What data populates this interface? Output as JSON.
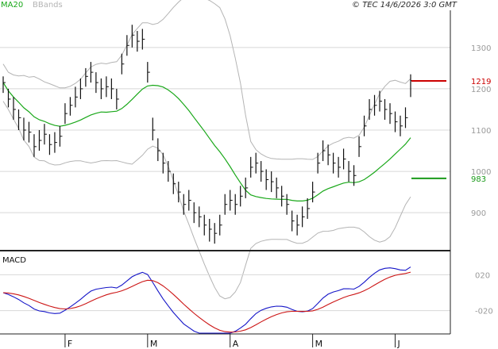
{
  "header": {
    "legend_ma": "MA20",
    "legend_bbands": "BBands",
    "credit": "© TEC 14/6/2026 3:0 GMT",
    "ma_color": "#1aa81a",
    "bbands_color": "#b4b4b4"
  },
  "chart_data": [
    {
      "type": "ohlc",
      "panel": "price",
      "y_ticks": [
        "1300",
        "1200",
        "1100",
        "1000",
        "900"
      ],
      "ylim": [
        810,
        1390
      ],
      "x_ticks": [
        "F",
        "M",
        "A",
        "M",
        "J"
      ],
      "x_tick_index": [
        12,
        28,
        44,
        60,
        76
      ],
      "markers": [
        {
          "label": "1219",
          "value": 1219,
          "color": "#cc0000"
        },
        {
          "label": "983",
          "value": 983,
          "color": "#1a9a1a"
        }
      ],
      "close": [
        1215,
        1175,
        1150,
        1130,
        1100,
        1095,
        1060,
        1075,
        1090,
        1065,
        1070,
        1085,
        1140,
        1160,
        1180,
        1200,
        1230,
        1240,
        1215,
        1200,
        1205,
        1200,
        1175,
        1260,
        1305,
        1330,
        1315,
        1320,
        1240,
        1100,
        1050,
        1020,
        1000,
        970,
        950,
        920,
        930,
        900,
        890,
        870,
        860,
        850,
        870,
        920,
        930,
        920,
        940,
        960,
        1010,
        1020,
        1000,
        980,
        975,
        960,
        940,
        920,
        880,
        870,
        890,
        910,
        950,
        1020,
        1050,
        1040,
        1020,
        1010,
        1030,
        1000,
        990,
        1060,
        1110,
        1150,
        1160,
        1170,
        1150,
        1140,
        1120,
        1110,
        1130,
        1220
      ],
      "high": [
        1230,
        1200,
        1180,
        1150,
        1130,
        1120,
        1090,
        1100,
        1115,
        1090,
        1095,
        1110,
        1165,
        1180,
        1205,
        1225,
        1250,
        1265,
        1240,
        1225,
        1230,
        1225,
        1200,
        1285,
        1330,
        1355,
        1340,
        1345,
        1265,
        1130,
        1080,
        1045,
        1025,
        995,
        975,
        945,
        955,
        925,
        915,
        895,
        885,
        875,
        895,
        945,
        955,
        945,
        965,
        985,
        1035,
        1045,
        1025,
        1005,
        1000,
        985,
        965,
        945,
        905,
        895,
        915,
        935,
        975,
        1045,
        1075,
        1065,
        1045,
        1035,
        1055,
        1025,
        1015,
        1085,
        1135,
        1175,
        1185,
        1195,
        1175,
        1165,
        1145,
        1135,
        1155,
        1235
      ],
      "low": [
        1190,
        1155,
        1125,
        1100,
        1075,
        1070,
        1035,
        1050,
        1065,
        1040,
        1045,
        1060,
        1115,
        1135,
        1155,
        1175,
        1205,
        1215,
        1190,
        1175,
        1180,
        1175,
        1150,
        1235,
        1280,
        1300,
        1290,
        1295,
        1215,
        1075,
        1025,
        995,
        975,
        945,
        925,
        895,
        905,
        875,
        865,
        845,
        830,
        825,
        845,
        895,
        905,
        895,
        915,
        935,
        985,
        995,
        975,
        955,
        950,
        935,
        915,
        895,
        855,
        845,
        865,
        885,
        925,
        995,
        1025,
        1015,
        995,
        985,
        1005,
        975,
        965,
        1035,
        1085,
        1125,
        1135,
        1145,
        1125,
        1115,
        1095,
        1085,
        1105,
        1180
      ]
    },
    {
      "type": "line",
      "panel": "macd",
      "title": "MACD",
      "y_ticks": [
        "020",
        "-020"
      ],
      "ylim": [
        -45,
        45
      ]
    }
  ]
}
